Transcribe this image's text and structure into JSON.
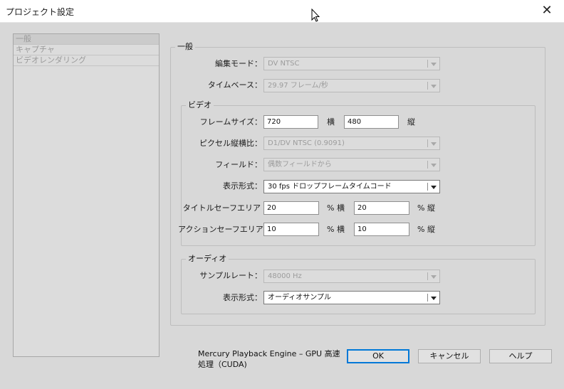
{
  "window": {
    "title": "プロジェクト設定"
  },
  "sidebar": {
    "items": [
      {
        "label": "一般"
      },
      {
        "label": "キャプチャ"
      },
      {
        "label": "ビデオレンダリング"
      }
    ]
  },
  "general": {
    "legend": "一般",
    "edit_mode": {
      "label": "編集モード：",
      "value": "DV NTSC"
    },
    "timebase": {
      "label": "タイムベース：",
      "value": "29.97 フレーム/秒"
    }
  },
  "video": {
    "legend": "ビデオ",
    "frame_size": {
      "label": "フレームサイズ：",
      "width": "720",
      "width_unit": "横",
      "height": "480",
      "height_unit": "縦"
    },
    "pixel_aspect": {
      "label": "ピクセル縦横比：",
      "value": "D1/DV NTSC (0.9091)"
    },
    "fields": {
      "label": "フィールド：",
      "value": "偶数フィールドから"
    },
    "display_format": {
      "label": "表示形式：",
      "value": "30 fps ドロップフレームタイムコード"
    },
    "title_safe": {
      "label": "タイトルセーフエリア",
      "h": "20",
      "h_unit": "% 横",
      "v": "20",
      "v_unit": "% 縦"
    },
    "action_safe": {
      "label": "アクションセーフエリア",
      "h": "10",
      "h_unit": "% 横",
      "v": "10",
      "v_unit": "% 縦"
    }
  },
  "audio": {
    "legend": "オーディオ",
    "sample_rate": {
      "label": "サンプルレート：",
      "value": "48000 Hz"
    },
    "display_format": {
      "label": "表示形式：",
      "value": "オーディオサンプル"
    }
  },
  "footer": {
    "engine_line1": "Mercury Playback Engine – GPU 高速",
    "engine_line2": "処理（CUDA)",
    "ok": "OK",
    "cancel": "キャンセル",
    "help": "ヘルプ"
  }
}
